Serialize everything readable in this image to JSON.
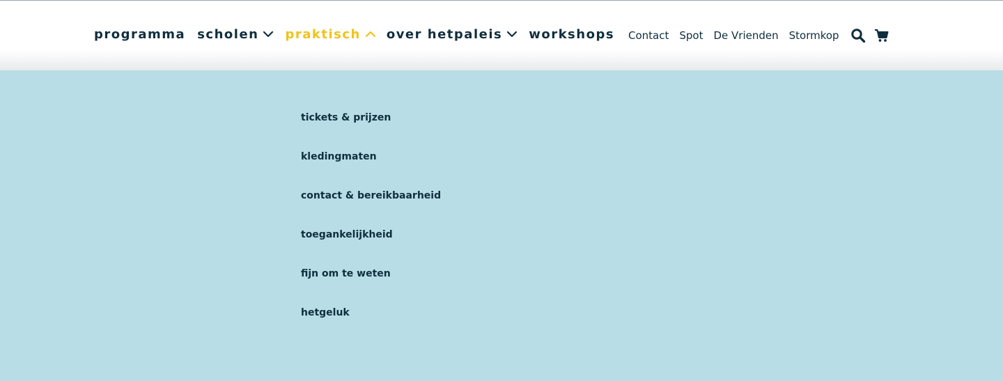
{
  "main_nav": {
    "items": [
      {
        "label": "programma",
        "has_dropdown": false
      },
      {
        "label": "scholen",
        "has_dropdown": true,
        "chevron": "chevron-down-icon"
      },
      {
        "label": "praktisch",
        "has_dropdown": true,
        "chevron": "chevron-up-icon",
        "active": true
      },
      {
        "label": "over hetpaleis",
        "has_dropdown": true,
        "chevron": "chevron-down-icon"
      },
      {
        "label": "workshops",
        "has_dropdown": false
      }
    ]
  },
  "secondary_nav": {
    "links": [
      "Contact",
      "Spot",
      "De Vrienden",
      "Stormkop"
    ],
    "icons": [
      "search-icon",
      "cart-icon"
    ]
  },
  "submenu": {
    "items": [
      "tickets & prijzen",
      "kledingmaten",
      "contact & bereikbaarheid",
      "toegankelijkheid",
      "fijn om te weten",
      "hetgeluk"
    ]
  },
  "colors": {
    "text_dark": "#0f2e3d",
    "active_accent": "#f2c21b",
    "dropdown_background": "#b8dde7",
    "header_background": "#ffffff"
  }
}
